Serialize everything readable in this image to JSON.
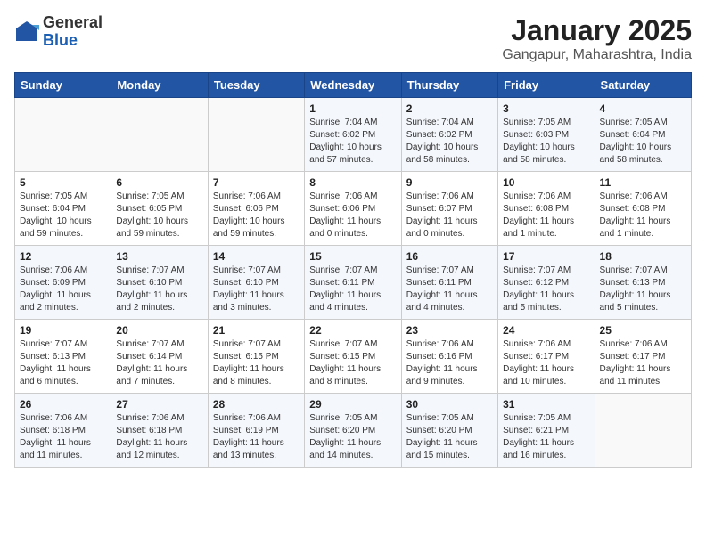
{
  "header": {
    "logo_general": "General",
    "logo_blue": "Blue",
    "title": "January 2025",
    "subtitle": "Gangapur, Maharashtra, India"
  },
  "weekdays": [
    "Sunday",
    "Monday",
    "Tuesday",
    "Wednesday",
    "Thursday",
    "Friday",
    "Saturday"
  ],
  "weeks": [
    [
      {
        "day": "",
        "info": ""
      },
      {
        "day": "",
        "info": ""
      },
      {
        "day": "",
        "info": ""
      },
      {
        "day": "1",
        "info": "Sunrise: 7:04 AM\nSunset: 6:02 PM\nDaylight: 10 hours\nand 57 minutes."
      },
      {
        "day": "2",
        "info": "Sunrise: 7:04 AM\nSunset: 6:02 PM\nDaylight: 10 hours\nand 58 minutes."
      },
      {
        "day": "3",
        "info": "Sunrise: 7:05 AM\nSunset: 6:03 PM\nDaylight: 10 hours\nand 58 minutes."
      },
      {
        "day": "4",
        "info": "Sunrise: 7:05 AM\nSunset: 6:04 PM\nDaylight: 10 hours\nand 58 minutes."
      }
    ],
    [
      {
        "day": "5",
        "info": "Sunrise: 7:05 AM\nSunset: 6:04 PM\nDaylight: 10 hours\nand 59 minutes."
      },
      {
        "day": "6",
        "info": "Sunrise: 7:05 AM\nSunset: 6:05 PM\nDaylight: 10 hours\nand 59 minutes."
      },
      {
        "day": "7",
        "info": "Sunrise: 7:06 AM\nSunset: 6:06 PM\nDaylight: 10 hours\nand 59 minutes."
      },
      {
        "day": "8",
        "info": "Sunrise: 7:06 AM\nSunset: 6:06 PM\nDaylight: 11 hours\nand 0 minutes."
      },
      {
        "day": "9",
        "info": "Sunrise: 7:06 AM\nSunset: 6:07 PM\nDaylight: 11 hours\nand 0 minutes."
      },
      {
        "day": "10",
        "info": "Sunrise: 7:06 AM\nSunset: 6:08 PM\nDaylight: 11 hours\nand 1 minute."
      },
      {
        "day": "11",
        "info": "Sunrise: 7:06 AM\nSunset: 6:08 PM\nDaylight: 11 hours\nand 1 minute."
      }
    ],
    [
      {
        "day": "12",
        "info": "Sunrise: 7:06 AM\nSunset: 6:09 PM\nDaylight: 11 hours\nand 2 minutes."
      },
      {
        "day": "13",
        "info": "Sunrise: 7:07 AM\nSunset: 6:10 PM\nDaylight: 11 hours\nand 2 minutes."
      },
      {
        "day": "14",
        "info": "Sunrise: 7:07 AM\nSunset: 6:10 PM\nDaylight: 11 hours\nand 3 minutes."
      },
      {
        "day": "15",
        "info": "Sunrise: 7:07 AM\nSunset: 6:11 PM\nDaylight: 11 hours\nand 4 minutes."
      },
      {
        "day": "16",
        "info": "Sunrise: 7:07 AM\nSunset: 6:11 PM\nDaylight: 11 hours\nand 4 minutes."
      },
      {
        "day": "17",
        "info": "Sunrise: 7:07 AM\nSunset: 6:12 PM\nDaylight: 11 hours\nand 5 minutes."
      },
      {
        "day": "18",
        "info": "Sunrise: 7:07 AM\nSunset: 6:13 PM\nDaylight: 11 hours\nand 5 minutes."
      }
    ],
    [
      {
        "day": "19",
        "info": "Sunrise: 7:07 AM\nSunset: 6:13 PM\nDaylight: 11 hours\nand 6 minutes."
      },
      {
        "day": "20",
        "info": "Sunrise: 7:07 AM\nSunset: 6:14 PM\nDaylight: 11 hours\nand 7 minutes."
      },
      {
        "day": "21",
        "info": "Sunrise: 7:07 AM\nSunset: 6:15 PM\nDaylight: 11 hours\nand 8 minutes."
      },
      {
        "day": "22",
        "info": "Sunrise: 7:07 AM\nSunset: 6:15 PM\nDaylight: 11 hours\nand 8 minutes."
      },
      {
        "day": "23",
        "info": "Sunrise: 7:06 AM\nSunset: 6:16 PM\nDaylight: 11 hours\nand 9 minutes."
      },
      {
        "day": "24",
        "info": "Sunrise: 7:06 AM\nSunset: 6:17 PM\nDaylight: 11 hours\nand 10 minutes."
      },
      {
        "day": "25",
        "info": "Sunrise: 7:06 AM\nSunset: 6:17 PM\nDaylight: 11 hours\nand 11 minutes."
      }
    ],
    [
      {
        "day": "26",
        "info": "Sunrise: 7:06 AM\nSunset: 6:18 PM\nDaylight: 11 hours\nand 11 minutes."
      },
      {
        "day": "27",
        "info": "Sunrise: 7:06 AM\nSunset: 6:18 PM\nDaylight: 11 hours\nand 12 minutes."
      },
      {
        "day": "28",
        "info": "Sunrise: 7:06 AM\nSunset: 6:19 PM\nDaylight: 11 hours\nand 13 minutes."
      },
      {
        "day": "29",
        "info": "Sunrise: 7:05 AM\nSunset: 6:20 PM\nDaylight: 11 hours\nand 14 minutes."
      },
      {
        "day": "30",
        "info": "Sunrise: 7:05 AM\nSunset: 6:20 PM\nDaylight: 11 hours\nand 15 minutes."
      },
      {
        "day": "31",
        "info": "Sunrise: 7:05 AM\nSunset: 6:21 PM\nDaylight: 11 hours\nand 16 minutes."
      },
      {
        "day": "",
        "info": ""
      }
    ]
  ]
}
